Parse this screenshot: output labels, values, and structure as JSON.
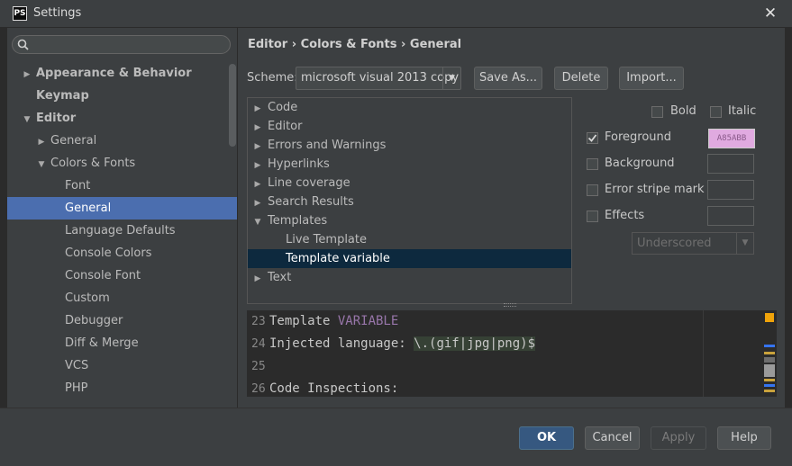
{
  "window": {
    "title": "Settings",
    "app_icon": "PS"
  },
  "search": {
    "placeholder": ""
  },
  "sidebar": {
    "items": [
      {
        "label": "Appearance & Behavior",
        "level": 0,
        "arrow": "▶",
        "bold": true
      },
      {
        "label": "Keymap",
        "level": 0,
        "arrow": "",
        "bold": true
      },
      {
        "label": "Editor",
        "level": 0,
        "arrow": "▼",
        "bold": true
      },
      {
        "label": "General",
        "level": 1,
        "arrow": "▶"
      },
      {
        "label": "Colors & Fonts",
        "level": 1,
        "arrow": "▼"
      },
      {
        "label": "Font",
        "level": 2,
        "arrow": ""
      },
      {
        "label": "General",
        "level": 2,
        "arrow": "",
        "selected": true
      },
      {
        "label": "Language Defaults",
        "level": 2,
        "arrow": ""
      },
      {
        "label": "Console Colors",
        "level": 2,
        "arrow": ""
      },
      {
        "label": "Console Font",
        "level": 2,
        "arrow": ""
      },
      {
        "label": "Custom",
        "level": 2,
        "arrow": ""
      },
      {
        "label": "Debugger",
        "level": 2,
        "arrow": ""
      },
      {
        "label": "Diff & Merge",
        "level": 2,
        "arrow": ""
      },
      {
        "label": "VCS",
        "level": 2,
        "arrow": ""
      },
      {
        "label": "PHP",
        "level": 2,
        "arrow": ""
      }
    ]
  },
  "breadcrumb": "Editor › Colors & Fonts › General",
  "scheme": {
    "label": "Scheme:",
    "value": "microsoft visual 2013 copy",
    "save_as": "Save As...",
    "delete": "Delete",
    "import": "Import..."
  },
  "attributes": [
    {
      "label": "Code",
      "arrow": "▶",
      "level": 0
    },
    {
      "label": "Editor",
      "arrow": "▶",
      "level": 0
    },
    {
      "label": "Errors and Warnings",
      "arrow": "▶",
      "level": 0
    },
    {
      "label": "Hyperlinks",
      "arrow": "▶",
      "level": 0
    },
    {
      "label": "Line coverage",
      "arrow": "▶",
      "level": 0
    },
    {
      "label": "Search Results",
      "arrow": "▶",
      "level": 0
    },
    {
      "label": "Templates",
      "arrow": "▼",
      "level": 0
    },
    {
      "label": "Live Template",
      "arrow": "",
      "level": 1
    },
    {
      "label": "Template variable",
      "arrow": "",
      "level": 1,
      "selected": true
    },
    {
      "label": "Text",
      "arrow": "▶",
      "level": 0
    }
  ],
  "options": {
    "bold": "Bold",
    "italic": "Italic",
    "foreground": "Foreground",
    "foreground_color": "A85ABB",
    "foreground_checked": true,
    "background": "Background",
    "error_stripe": "Error stripe mark",
    "effects": "Effects",
    "effect_type": "Underscored"
  },
  "preview": {
    "lines": [
      {
        "num": "23",
        "pre": "Template ",
        "hl": "VARIABLE",
        "post": ""
      },
      {
        "num": "24",
        "pre": "Injected language: ",
        "inj": "\\.(gif|jpg|png)$",
        "post": ""
      },
      {
        "num": "25",
        "pre": ""
      },
      {
        "num": "26",
        "pre": "Code Inspections:"
      }
    ]
  },
  "buttons": {
    "ok": "OK",
    "cancel": "Cancel",
    "apply": "Apply",
    "help": "Help"
  },
  "colors": {
    "selection": "#4b6eaf",
    "accent": "#365880",
    "template_var": "#9876aa"
  }
}
